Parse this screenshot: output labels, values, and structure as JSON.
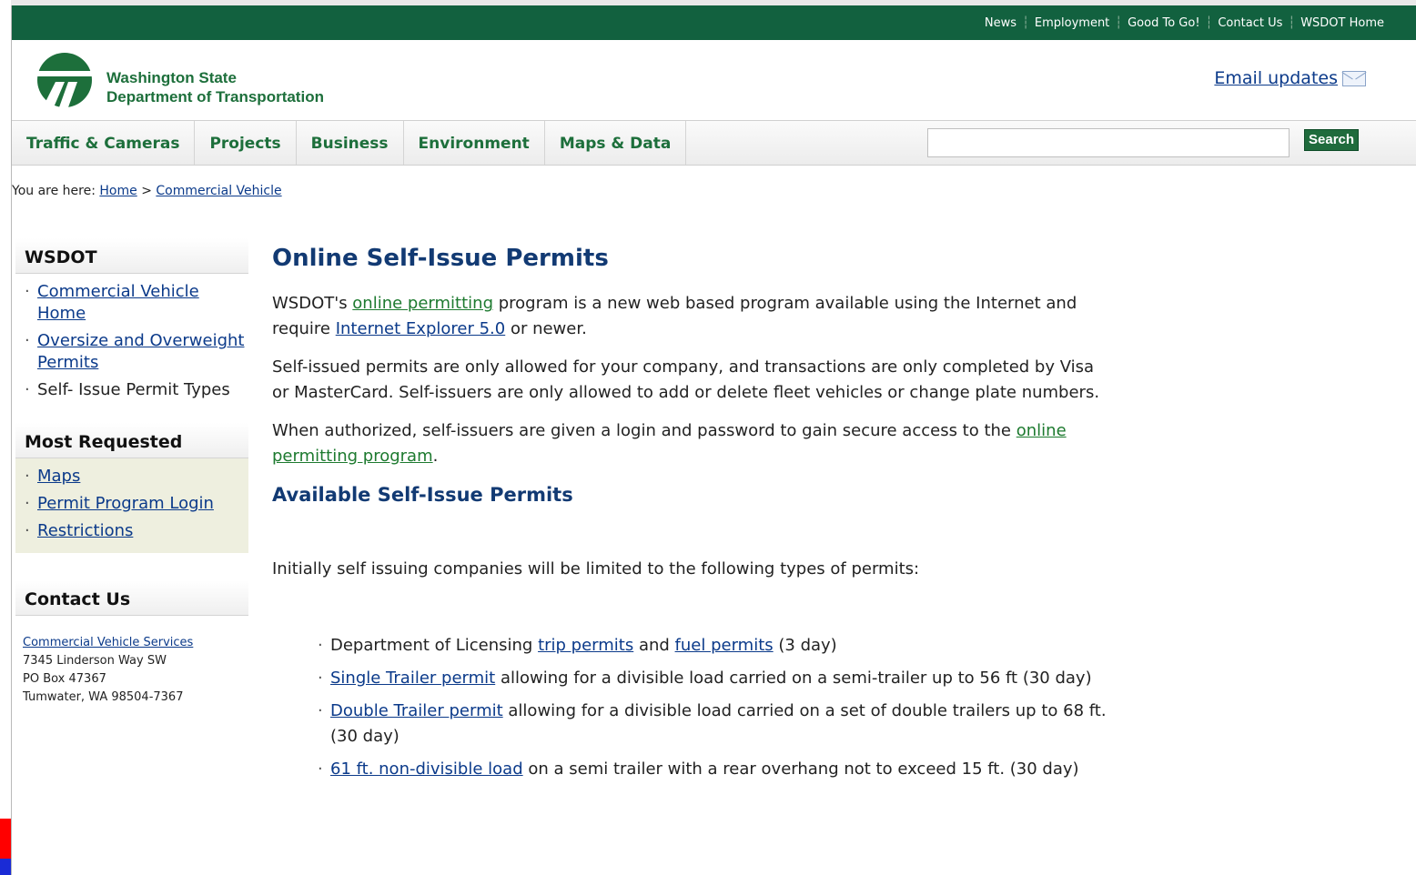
{
  "top_links": [
    "News",
    "Employment",
    "Good To Go!",
    "Contact Us",
    "WSDOT Home"
  ],
  "brand": {
    "line1": "Washington State",
    "line2": "Department of Transportation"
  },
  "email_updates": "Email updates",
  "nav": {
    "tabs": [
      "Traffic & Cameras",
      "Projects",
      "Business",
      "Environment",
      "Maps & Data"
    ],
    "search_label": "Search",
    "search_value": ""
  },
  "breadcrumb": {
    "prefix": "You are here:",
    "home": "Home",
    "sep": ">",
    "current": "Commercial Vehicle"
  },
  "sidebar": {
    "wsdot_title": "WSDOT",
    "wsdot_items": [
      {
        "label": "Commercial Vehicle Home",
        "link": true
      },
      {
        "label": "Oversize and Overweight Permits",
        "link": true
      },
      {
        "label": "Self- Issue Permit Types",
        "link": false
      }
    ],
    "most_title": "Most Requested",
    "most_items": [
      "Maps",
      "Permit Program Login",
      "Restrictions"
    ],
    "contact_title": "Contact Us",
    "contact": {
      "name": "Commercial Vehicle Services",
      "addr1": "7345 Linderson Way SW",
      "addr2": "PO Box 47367",
      "addr3": "Tumwater, WA 98504-7367"
    }
  },
  "main": {
    "title": "Online Self-Issue Permits",
    "p1_a": "WSDOT's ",
    "p1_link": "online permitting",
    "p1_b": " program is a new web based program available using the Internet and require ",
    "p1_link2": "Internet Explorer 5.0",
    "p1_c": " or newer.",
    "p2": "Self-issued permits are only allowed for your company, and transactions are only completed by Visa or MasterCard. Self-issuers are only allowed to add or delete fleet vehicles or change plate numbers.",
    "p3_a": "When authorized, self-issuers are given a login and password to gain secure access to the ",
    "p3_link": "online permitting program",
    "p3_b": ".",
    "subtitle": "Available Self-Issue Permits",
    "intro": "Initially self issuing companies will be limited to the following types of permits:",
    "permits": {
      "li1_a": "Department of Licensing ",
      "li1_link1": "trip permits",
      "li1_b": " and ",
      "li1_link2": "fuel permits",
      "li1_c": " (3 day)",
      "li2_link": "Single Trailer permit",
      "li2_text": " allowing for a divisible load carried on a semi-trailer up to 56 ft (30 day)",
      "li3_link": "Double Trailer permit",
      "li3_text": " allowing for a divisible load carried on a set of double trailers up to 68 ft. (30 day)",
      "li4_link": "61 ft. non-divisible load",
      "li4_text": " on a semi trailer with a rear overhang not to exceed 15 ft. (30 day)"
    }
  },
  "colors": {
    "topbar": "#12613f",
    "brand_green": "#1d6f3b",
    "heading_blue": "#123a73",
    "link_blue": "#0b3a8a",
    "most_bg": "#eeefdf"
  }
}
